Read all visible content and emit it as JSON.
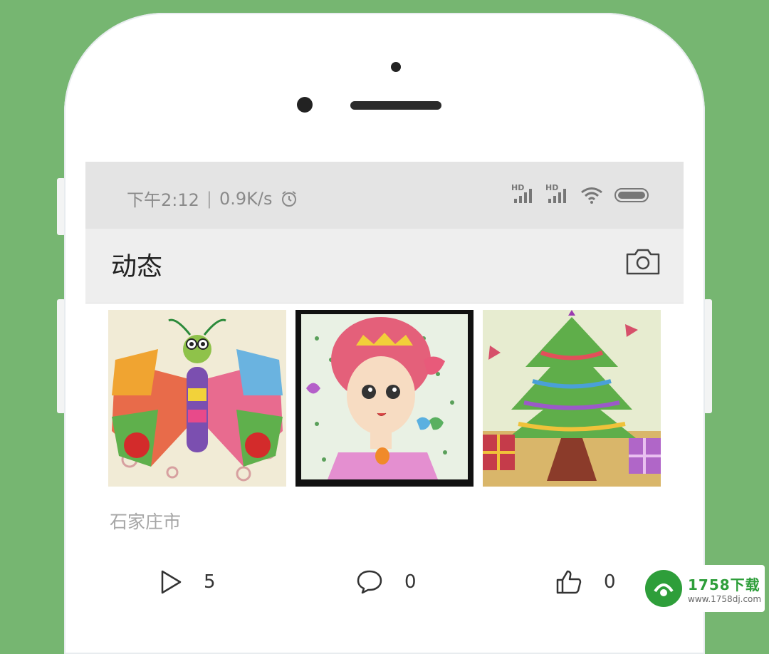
{
  "status_bar": {
    "time": "下午2:12",
    "separator": "|",
    "speed": "0.9K/s",
    "hd1": "HD",
    "hd2": "HD"
  },
  "header": {
    "title": "动态"
  },
  "post": {
    "location": "石家庄市",
    "plays": "5",
    "comments": "0",
    "likes": "0"
  },
  "watermark": {
    "brand": "1758下载",
    "url": "www.1758dj.com"
  },
  "colors": {
    "background": "#76b671",
    "status_bar": "#e4e4e4",
    "header": "#eeeeee",
    "brand_green": "#2e9e3a"
  }
}
